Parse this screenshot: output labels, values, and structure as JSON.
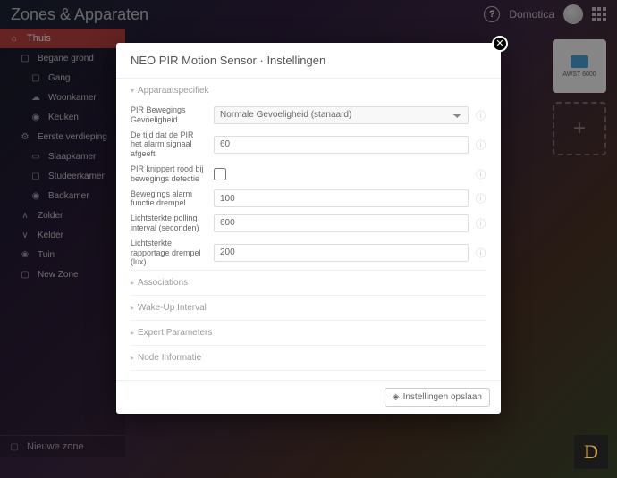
{
  "topbar": {
    "title": "Zones & Apparaten",
    "user": "Domotica"
  },
  "sidebar": {
    "items": [
      {
        "label": "Thuis",
        "icon": "⌂",
        "active": true
      },
      {
        "label": "Begane grond",
        "icon": "▢",
        "sub": true
      },
      {
        "label": "Gang",
        "icon": "▢",
        "sub2": true
      },
      {
        "label": "Woonkamer",
        "icon": "☁",
        "sub2": true
      },
      {
        "label": "Keuken",
        "icon": "◉",
        "sub2": true
      },
      {
        "label": "Eerste verdieping",
        "icon": "⚙",
        "sub": true
      },
      {
        "label": "Slaapkamer",
        "icon": "▭",
        "sub2": true
      },
      {
        "label": "Studeerkamer",
        "icon": "▢",
        "sub2": true
      },
      {
        "label": "Badkamer",
        "icon": "◉",
        "sub2": true
      },
      {
        "label": "Zolder",
        "icon": "∧",
        "sub": true
      },
      {
        "label": "Kelder",
        "icon": "∨",
        "sub": true
      },
      {
        "label": "Tuin",
        "icon": "❀",
        "sub": true
      },
      {
        "label": "New Zone",
        "icon": "▢",
        "sub": true
      }
    ],
    "footer": "Nieuwe zone"
  },
  "tiles": {
    "device": "AWST 6000"
  },
  "modal": {
    "title": "NEO PIR Motion Sensor · Instellingen",
    "sections": {
      "s0": "Apparaatspecifiek",
      "s1": "Associations",
      "s2": "Wake-Up Interval",
      "s3": "Expert Parameters",
      "s4": "Node Informatie"
    },
    "fields": {
      "f0": {
        "label": "PIR Bewegings Gevoeligheid",
        "value": "Normale Gevoeligheid (stanaard)"
      },
      "f1": {
        "label": "De tijd dat de PIR het alarm signaal afgeeft",
        "value": "60"
      },
      "f2": {
        "label": "PIR knippert rood bij bewegings detectie"
      },
      "f3": {
        "label": "Bewegings alarm functie drempel",
        "value": "100"
      },
      "f4": {
        "label": "Lichtsterkte polling interval (seconden)",
        "value": "600"
      },
      "f5": {
        "label": "Lichtsterkte rapportage drempel (lux)",
        "value": "200"
      }
    },
    "save": "Instellingen opslaan"
  },
  "badge": "D"
}
